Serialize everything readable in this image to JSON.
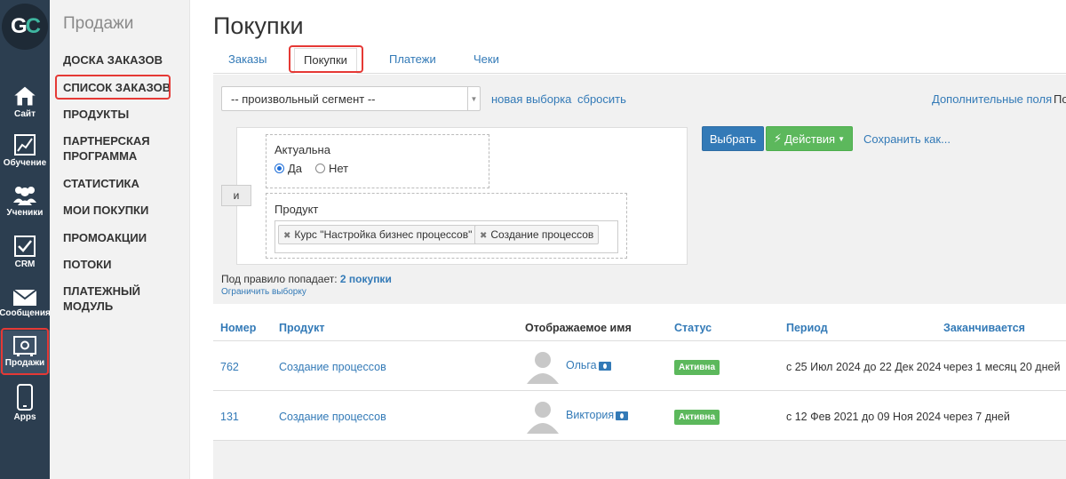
{
  "logo": {
    "left": "G",
    "right": "C"
  },
  "rail": {
    "items": [
      {
        "label": "Сайт",
        "icon": "home-icon"
      },
      {
        "label": "Обучение",
        "icon": "chart-icon"
      },
      {
        "label": "Ученики",
        "icon": "users-icon"
      },
      {
        "label": "CRM",
        "icon": "checkbox-icon"
      },
      {
        "label": "Сообщения",
        "icon": "envelope-icon"
      },
      {
        "label": "Продажи",
        "icon": "safe-icon"
      },
      {
        "label": "Apps",
        "icon": "phone-icon"
      }
    ]
  },
  "subnav": {
    "title": "Продажи",
    "items": [
      {
        "label": "Доска заказов"
      },
      {
        "label": "Список заказов"
      },
      {
        "label": "Продукты"
      },
      {
        "label": "Партнерская программа"
      },
      {
        "label": "Статистика"
      },
      {
        "label": "Мои покупки"
      },
      {
        "label": "Промоакции"
      },
      {
        "label": "Потоки"
      },
      {
        "label": "Платежный модуль"
      }
    ]
  },
  "main": {
    "title": "Покупки",
    "tabs": [
      "Заказы",
      "Покупки",
      "Платежи",
      "Чеки"
    ]
  },
  "filters": {
    "segment_value": "-- произвольный сегмент --",
    "new_selection": "новая выборка",
    "reset": "сбросить",
    "extra_fields": "Дополнительные поля",
    "extra_clipped": "По",
    "and_label": "и",
    "cond_actual": {
      "label": "Актуальна",
      "yes": "Да",
      "no": "Нет",
      "selected": "yes"
    },
    "cond_product": {
      "label": "Продукт",
      "tags": [
        "Курс \"Настройка бизнес процессов\"",
        "Создание процессов"
      ]
    },
    "select_btn": "Выбрать",
    "actions_btn": "Действия",
    "save_as": "Сохранить как...",
    "rule_count_prefix": "Под правило попадает:",
    "rule_count_value": "2 покупки",
    "limit_link": "Ограничить выборку"
  },
  "table": {
    "headers": [
      "Номер",
      "Продукт",
      "Отображаемое имя",
      "Статус",
      "Период",
      "Заканчивается"
    ],
    "rows": [
      {
        "number": "762",
        "product": "Создание процессов",
        "name": "Ольга",
        "status": "Активна",
        "period": "с 25 Июл 2024 до 22 Дек 2024",
        "ends": "через 1 месяц 20 дней"
      },
      {
        "number": "131",
        "product": "Создание процессов",
        "name": "Виктория",
        "status": "Активна",
        "period": "с 12 Фев 2021 до 09 Ноя 2024",
        "ends": "через 7 дней"
      }
    ]
  },
  "colors": {
    "rail": "#2c3e50",
    "link": "#337ab7",
    "primary": "#337ab7",
    "success": "#5cb85c",
    "highlight": "#e53935"
  }
}
